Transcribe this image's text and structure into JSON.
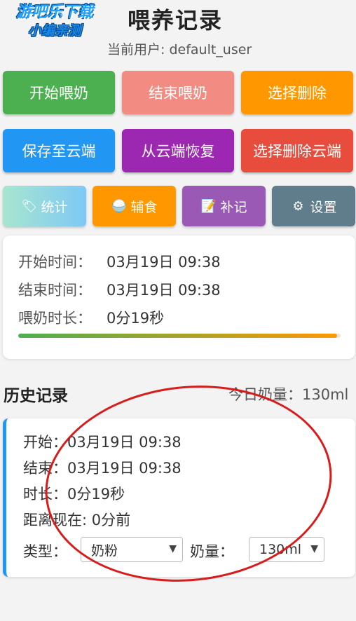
{
  "watermark": {
    "line1": "游吧乐下载",
    "line2": "小编亲测"
  },
  "header": {
    "title": "喂养记录",
    "user": "当前用户: default_user"
  },
  "buttons": {
    "start": "开始喂奶",
    "end": "结束喂奶",
    "select_delete": "选择删除",
    "save_cloud": "保存至云端",
    "restore_cloud": "从云端恢复",
    "delete_cloud": "选择删除云端"
  },
  "small_buttons": {
    "stats": "统计",
    "food": "辅食",
    "makeup": "补记",
    "settings": "设置"
  },
  "icons": {
    "stats": "tag-icon",
    "food": "rice-bowl-icon",
    "makeup": "memo-icon",
    "settings": "gear-icon"
  },
  "session": {
    "start_label": "开始时间：",
    "start_value": "03月19日 09:38",
    "end_label": "结束时间：",
    "end_value": "03月19日 09:38",
    "duration_label": "喂奶时长：",
    "duration_value": "0分19秒",
    "progress": 0.99
  },
  "history": {
    "title": "历史记录",
    "today_total": "今日奶量：130ml",
    "records": [
      {
        "start": "开始：03月19日 09:38",
        "end": "结束：03月19日 09:38",
        "duration": "时长：0分19秒",
        "since": "距离现在: 0分前",
        "type_label": "类型：",
        "type_value": "奶粉",
        "amount_label": "奶量：",
        "amount_value": "130ml"
      }
    ]
  },
  "colors": {
    "green": "#4caf50",
    "pink": "#f28b82",
    "orange": "#ff9800",
    "blue": "#2196f3",
    "purple": "#9c27b0",
    "red": "#e74c3c",
    "annotation": "#d81b1b"
  }
}
